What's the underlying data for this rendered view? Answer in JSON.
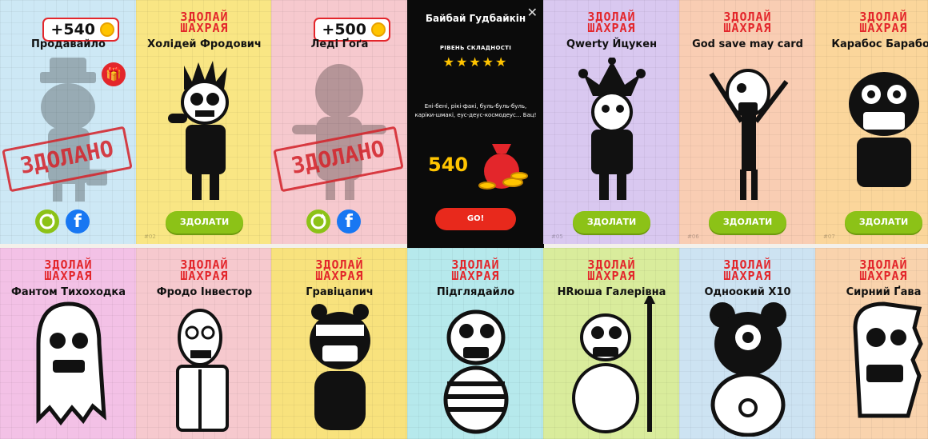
{
  "brand_label": "ЗДОЛАЙ ШАХРАЯ",
  "cta_label": "ЗДОЛАТИ",
  "defeated_label": "ЗДОЛАНО",
  "colors": {
    "accent_red": "#e3262b",
    "button_green": "#8cc217",
    "coin_gold": "#ffc400"
  },
  "row1": [
    {
      "name": "Продавайло",
      "bg": "#cde8f5",
      "price": "+540",
      "defeated": true
    },
    {
      "name": "Холідей Фродович",
      "bg": "#f9e684",
      "number": "#02"
    },
    {
      "name": "Леді Ґоґа",
      "bg": "#f6c9ce",
      "price": "+500",
      "defeated": true
    },
    {
      "name": "Qwerty Йцукен",
      "bg": "#d9c8f0",
      "number": "#05"
    },
    {
      "name": "God save may card",
      "bg": "#f9cdb3",
      "number": "#06"
    },
    {
      "name": "Карабос Барабос",
      "bg": "#fbd69b",
      "number": "#07"
    }
  ],
  "popup": {
    "title": "Байбай Гудбайкін",
    "difficulty_label": "РІВЕНЬ СКЛАДНОСТІ",
    "stars": "★★★★★",
    "description": "Ені-бені, рікі-факі, буль-буль-буль, каріки-шмакі, еус-деус-космодеус... Бац!",
    "amount": "540",
    "go_label": "GO!",
    "close_icon": "close-icon"
  },
  "row2": [
    {
      "name": "Фантом Тихоходка",
      "bg": "#f3c1e6"
    },
    {
      "name": "Фродо Інвестор",
      "bg": "#f6c9ce"
    },
    {
      "name": "Гравіцапич",
      "bg": "#f8e27d"
    },
    {
      "name": "Підглядайло",
      "bg": "#b6e9ec"
    },
    {
      "name": "НRюша Галерівна",
      "bg": "#d9ec9c"
    },
    {
      "name": "Одноокий Х10",
      "bg": "#cde3f2"
    },
    {
      "name": "Сирний Ґава",
      "bg": "#f9d3ad"
    }
  ]
}
